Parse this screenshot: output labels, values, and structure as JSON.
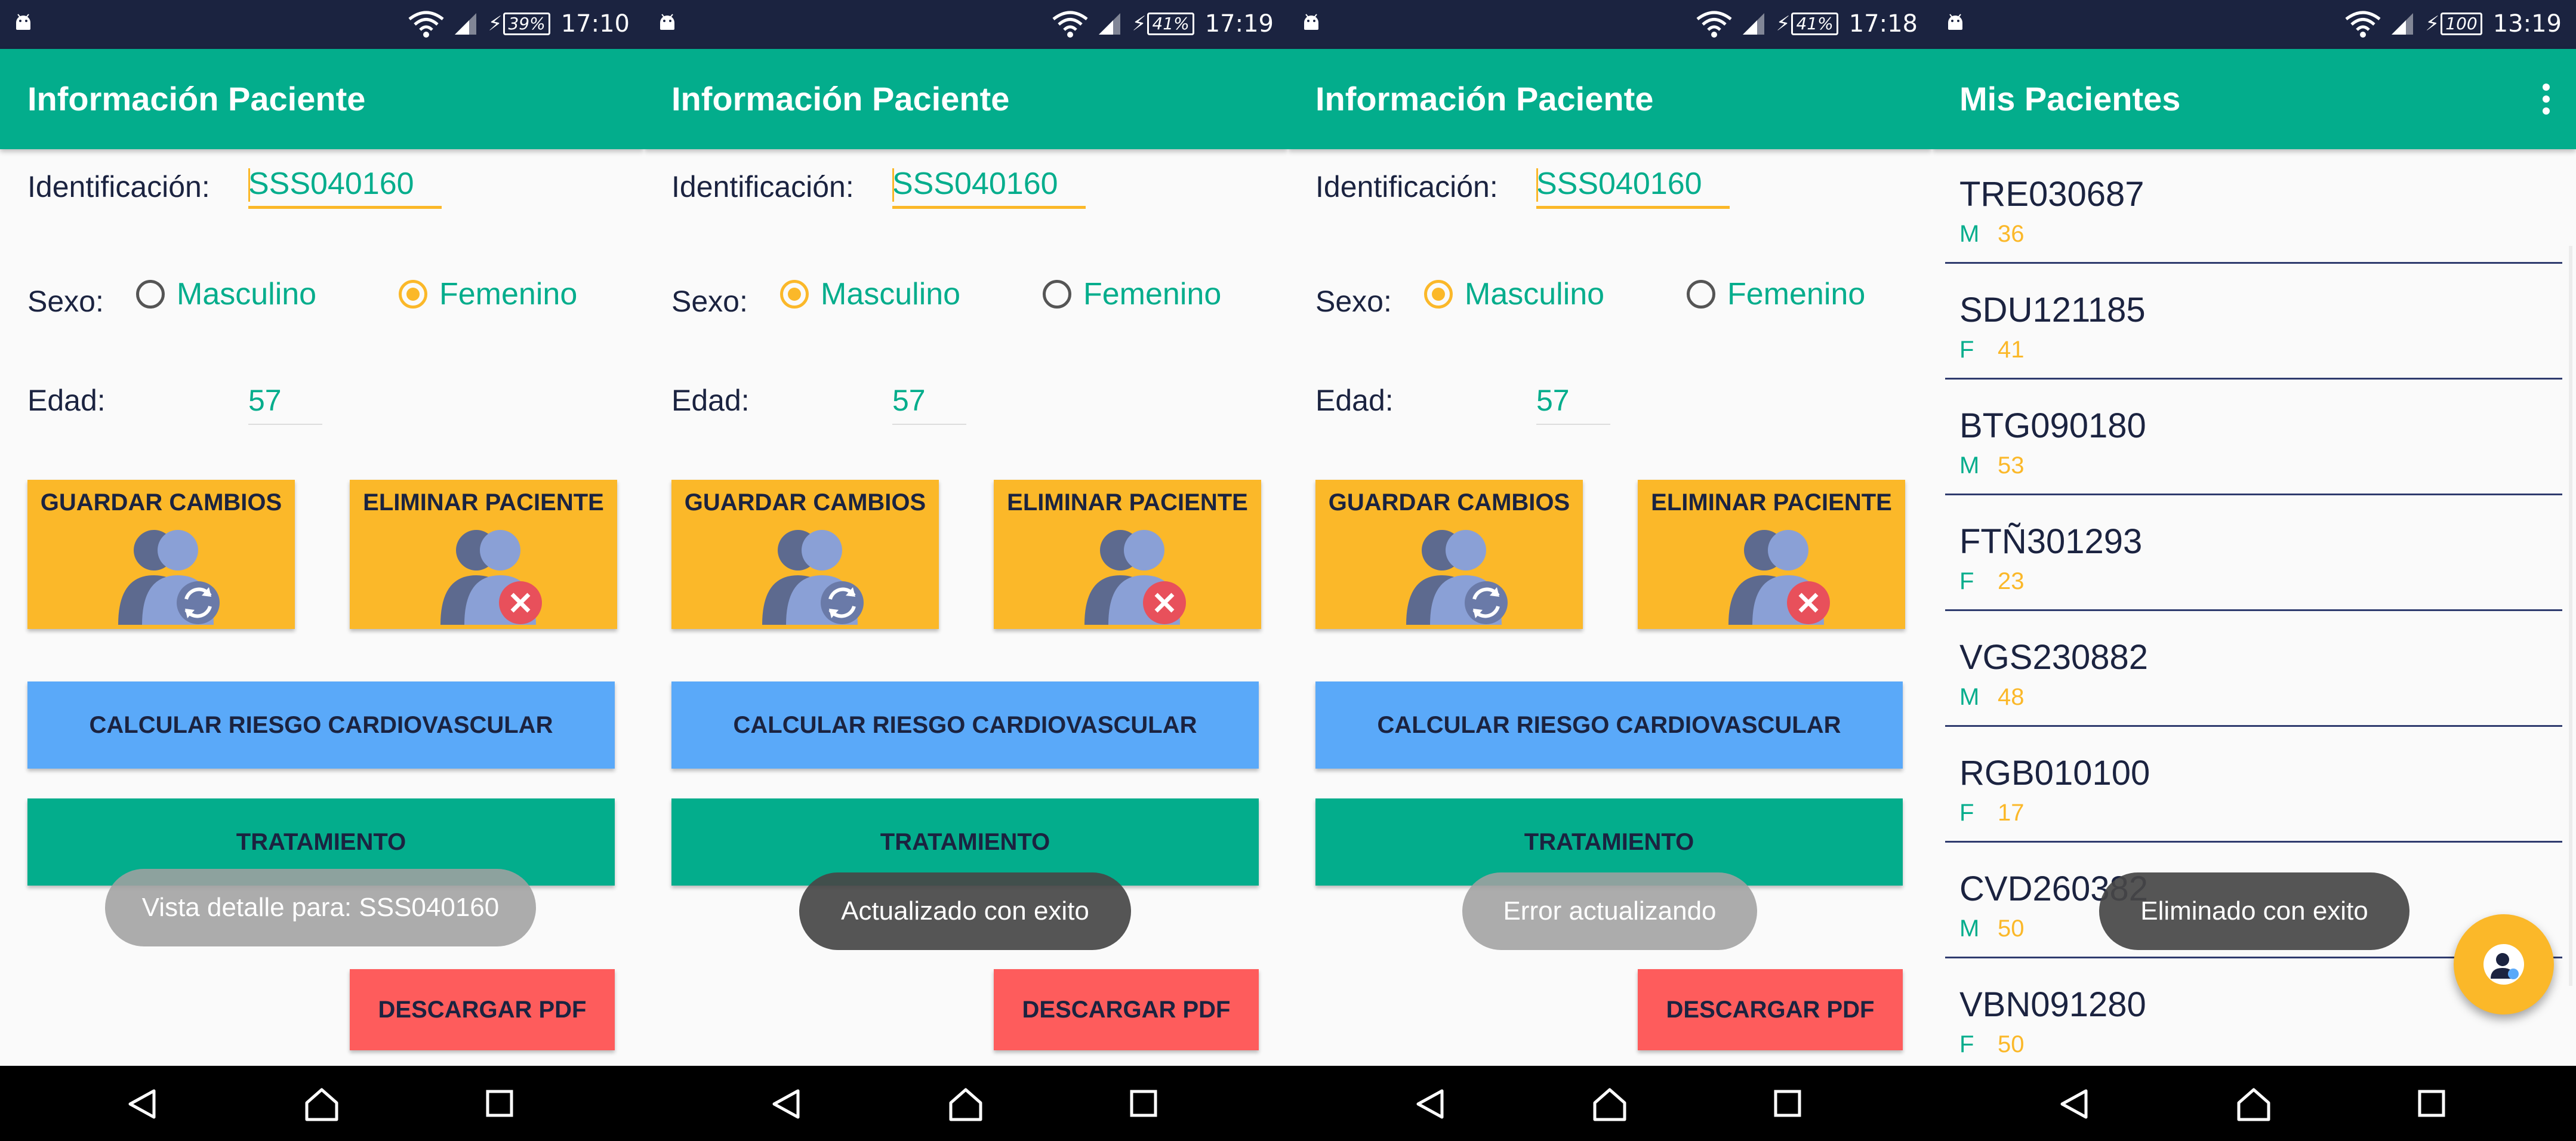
{
  "status_bars": [
    {
      "battery": "39%",
      "time": "17:10"
    },
    {
      "battery": "41%",
      "time": "17:19"
    },
    {
      "battery": "41%",
      "time": "17:18"
    },
    {
      "battery": "100",
      "time": "13:19"
    }
  ],
  "detail": {
    "title": "Información Paciente",
    "id_label": "Identificación:",
    "id_value": "SSS040160",
    "sex_label": "Sexo:",
    "sex_male": "Masculino",
    "sex_female": "Femenino",
    "age_label": "Edad:",
    "age_value": "57",
    "save_button": "GUARDAR CAMBIOS",
    "delete_button": "ELIMINAR PACIENTE",
    "calc_button": "CALCULAR RIESGO CARDIOVASCULAR",
    "treatment_button": "TRATAMIENTO",
    "pdf_button": "DESCARGAR PDF"
  },
  "screens": [
    {
      "selected_sex": "Femenino",
      "toast": "Vista detalle para: SSS040160"
    },
    {
      "selected_sex": "Masculino",
      "toast": "Actualizado con exito"
    },
    {
      "selected_sex": "Masculino",
      "toast": "Error actualizando"
    }
  ],
  "list_screen": {
    "title": "Mis Pacientes",
    "toast": "Eliminado con exito",
    "patients": [
      {
        "id": "TRE030687",
        "sex": "M",
        "age": "36"
      },
      {
        "id": "SDU121185",
        "sex": "F",
        "age": "41"
      },
      {
        "id": "BTG090180",
        "sex": "M",
        "age": "53"
      },
      {
        "id": "FTÑ301293",
        "sex": "F",
        "age": "23"
      },
      {
        "id": "VGS230882",
        "sex": "M",
        "age": "48"
      },
      {
        "id": "RGB010100",
        "sex": "F",
        "age": "17"
      },
      {
        "id": "CVD260382",
        "sex": "M",
        "age": "50"
      },
      {
        "id": "VBN091280",
        "sex": "F",
        "age": "50"
      }
    ]
  },
  "colors": {
    "primary": "#03ad8c",
    "accent": "#fbb829",
    "status_bar": "#1b2340",
    "calc_button": "#5aa9f9",
    "pdf_button": "#fe5c5c"
  },
  "icons": {
    "status": [
      "android-icon",
      "wifi-icon",
      "signal-icon",
      "charging-icon",
      "battery-icon"
    ],
    "save_tile": "users-sync-icon",
    "delete_tile": "users-delete-icon",
    "fab": "add-patient-icon",
    "nav": [
      "back-icon",
      "home-icon",
      "recents-icon"
    ]
  }
}
